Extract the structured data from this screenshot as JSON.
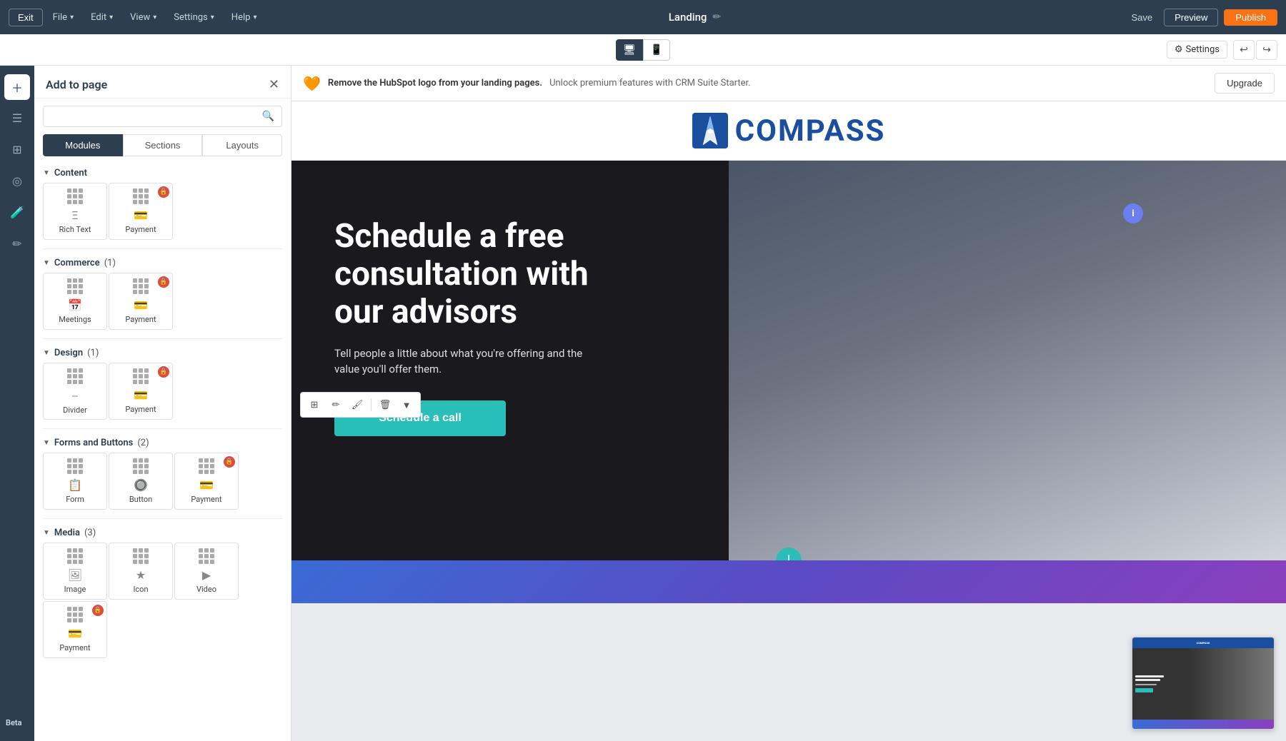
{
  "topbar": {
    "exit_label": "Exit",
    "file_label": "File",
    "edit_label": "Edit",
    "view_label": "View",
    "settings_label": "Settings",
    "help_label": "Help",
    "page_title": "Landing",
    "save_label": "Save",
    "preview_label": "Preview",
    "publish_label": "Publish"
  },
  "secondbar": {
    "settings_label": "Settings",
    "desktop_icon": "🖥",
    "mobile_icon": "📱"
  },
  "add_panel": {
    "title": "Add to page",
    "tabs": [
      "Modules",
      "Sections",
      "Layouts"
    ],
    "active_tab": "Modules",
    "search_placeholder": "",
    "sections": [
      {
        "label": "Content",
        "count": "",
        "modules": [
          {
            "label": "Rich Text",
            "locked": false
          },
          {
            "label": "Payment",
            "locked": true
          }
        ]
      },
      {
        "label": "Commerce",
        "count": "(1)",
        "modules": [
          {
            "label": "Meetings",
            "locked": false
          },
          {
            "label": "Payment",
            "locked": true
          }
        ]
      },
      {
        "label": "Design",
        "count": "(1)",
        "modules": [
          {
            "label": "Divider",
            "locked": false
          },
          {
            "label": "Payment",
            "locked": true
          }
        ]
      },
      {
        "label": "Forms and Buttons",
        "count": "(2)",
        "modules": [
          {
            "label": "Form",
            "locked": false
          },
          {
            "label": "Button",
            "locked": false
          },
          {
            "label": "Payment",
            "locked": true
          }
        ]
      },
      {
        "label": "Media",
        "count": "(3)",
        "modules": [
          {
            "label": "Image",
            "locked": false
          },
          {
            "label": "Icon",
            "locked": false
          },
          {
            "label": "Video",
            "locked": false
          },
          {
            "label": "Payment",
            "locked": true
          }
        ]
      }
    ]
  },
  "upgrade_bar": {
    "text_bold": "Remove the HubSpot logo from your landing pages.",
    "text_sub": "Unlock premium features with CRM Suite Starter.",
    "btn_label": "Upgrade"
  },
  "hero": {
    "title": "Schedule a free consultation with our advisors",
    "subtitle": "Tell people a little about what you're offering and the value you'll offer them.",
    "cta_label": "Schedule a call"
  },
  "logo": {
    "text": "COMPASS"
  },
  "canvas_tools": {
    "layout_icon": "⊞",
    "edit_icon": "✏",
    "brush_icon": "🖌",
    "trash_icon": "🗑",
    "more_icon": "▼"
  },
  "beta_label": "Beta"
}
